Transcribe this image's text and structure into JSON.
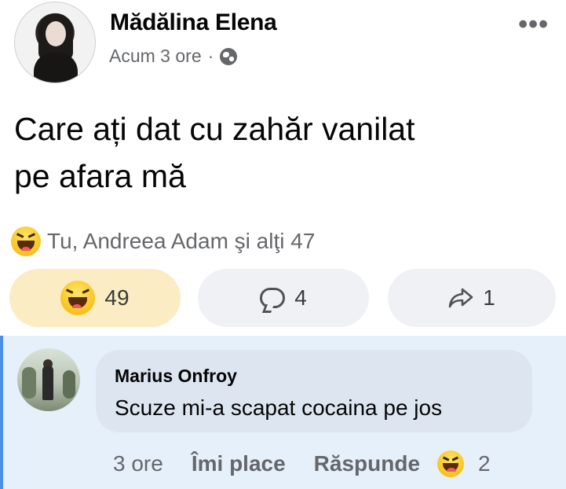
{
  "post": {
    "author": "Mădălina Elena",
    "time": "Acum 3 ore",
    "separator": "·",
    "more_icon": "more-icon",
    "text_line1": "Care ați dat cu zahăr vanilat",
    "text_line2": "pe afara mă"
  },
  "reactions": {
    "summary": "Tu, Andreea Adam şi alţi 47",
    "emoji": "haha-emoji"
  },
  "actions": {
    "haha_count": "49",
    "comment_count": "4",
    "share_count": "1"
  },
  "comment": {
    "name": "Marius Onfroy",
    "text": "Scuze mi-a scapat cocaina pe jos",
    "time": "3 ore",
    "like_label": "Îmi place",
    "reply_label": "Răspunde",
    "reaction_count": "2"
  },
  "colors": {
    "haha_pill": "#fbecc4",
    "pill": "#eff1f4",
    "comment_bg": "#e6f0fb",
    "comment_bar": "#4a8fe7",
    "secondary_text": "#65676b"
  }
}
